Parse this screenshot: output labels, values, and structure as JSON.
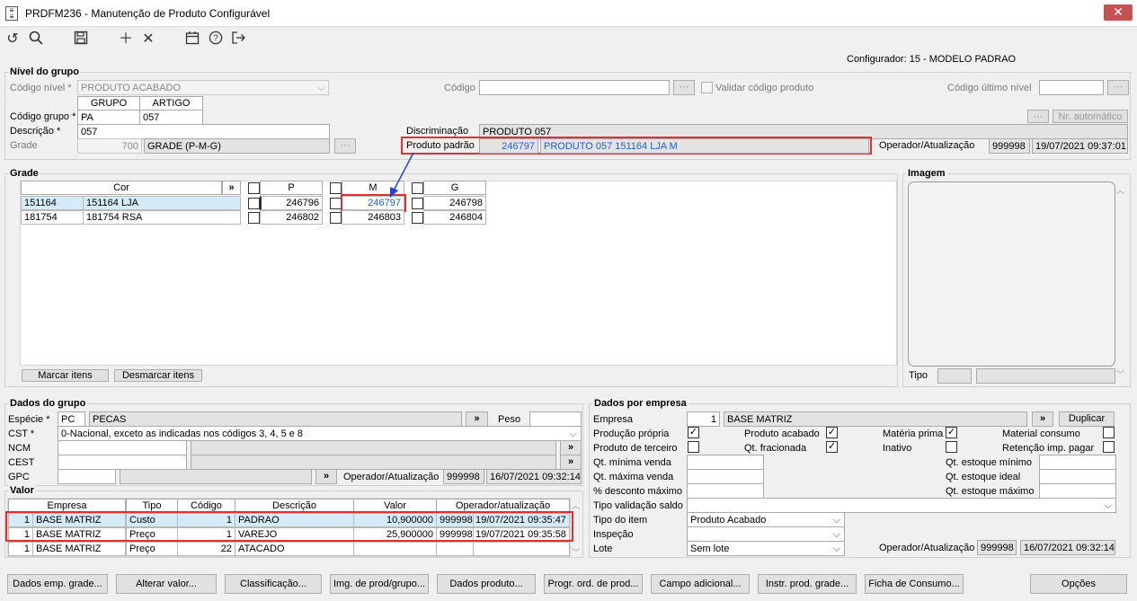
{
  "window": {
    "title": "PRDFM236 - Manutenção de Produto Configurável",
    "close": "✕"
  },
  "configurador": "Configurador: 15 - MODELO PADRAO",
  "nivel": {
    "title": "Nível do grupo",
    "codigo_nivel_label": "Código nível *",
    "codigo_nivel_value": "PRODUTO ACABADO",
    "codigo_label": "Código",
    "validar_label": "Validar código produto",
    "codigo_ultimo_label": "Código último nível",
    "nr_auto": "Nr. automático",
    "grupo_hdr": "GRUPO",
    "artigo_hdr": "ARTIGO",
    "codigo_grupo_label": "Código grupo *",
    "grupo_val": "PA",
    "artigo_val": "057",
    "descricao_label": "Descrição *",
    "descricao_val": "057",
    "grade_label": "Grade",
    "grade_num": "700",
    "grade_desc": "GRADE (P-M-G)",
    "discriminacao_label": "Discriminação",
    "discriminacao_val": "PRODUTO 057",
    "produto_padrao_label": "Produto padrão",
    "produto_padrao_code": "246797",
    "produto_padrao_desc": "PRODUTO 057 151164 LJA M",
    "oper_label": "Operador/Atualização",
    "oper_user": "999998",
    "oper_date": "19/07/2021 09:37:01"
  },
  "grade": {
    "title": "Grade",
    "cor_hdr": "Cor",
    "expand": "»",
    "sizes": [
      "P",
      "M",
      "G"
    ],
    "rows": [
      {
        "code": "151164",
        "name": "151164 LJA",
        "p": "246796",
        "m": "246797",
        "g": "246798"
      },
      {
        "code": "181754",
        "name": "181754 RSA",
        "p": "246802",
        "m": "246803",
        "g": "246804"
      }
    ],
    "marcar": "Marcar itens",
    "desmarcar": "Desmarcar itens"
  },
  "imagem": {
    "title": "Imagem",
    "tipo_label": "Tipo"
  },
  "dados_grupo": {
    "title": "Dados do grupo",
    "especie_label": "Espécie *",
    "especie_code": "PC",
    "especie_desc": "PECAS",
    "peso_label": "Peso",
    "cst_label": "CST *",
    "cst_val": "0-Nacional, exceto as indicadas nos códigos 3, 4, 5 e 8",
    "ncm_label": "NCM",
    "cest_label": "CEST",
    "gpc_label": "GPC",
    "oper_label": "Operador/Atualização",
    "oper_user": "999998",
    "oper_date": "16/07/2021 09:32:14"
  },
  "valor": {
    "title": "Valor",
    "headers": [
      "Empresa",
      "Tipo",
      "Código",
      "Descrição",
      "Valor",
      "Operador/atualização"
    ],
    "rows": [
      {
        "emp_num": "1",
        "empresa": "BASE MATRIZ",
        "tipo": "Custo",
        "codigo": "1",
        "descricao": "PADRAO",
        "valor": "10,900000",
        "user": "999998",
        "date": "19/07/2021 09:35:47"
      },
      {
        "emp_num": "1",
        "empresa": "BASE MATRIZ",
        "tipo": "Preço",
        "codigo": "1",
        "descricao": "VAREJO",
        "valor": "25,900000",
        "user": "999998",
        "date": "19/07/2021 09:35:58"
      },
      {
        "emp_num": "1",
        "empresa": "BASE MATRIZ",
        "tipo": "Preço",
        "codigo": "22",
        "descricao": "ATACADO",
        "valor": "",
        "user": "",
        "date": ""
      }
    ]
  },
  "dados_empresa": {
    "title": "Dados por empresa",
    "empresa_label": "Empresa",
    "empresa_num": "1",
    "empresa_desc": "BASE MATRIZ",
    "duplicar": "Duplicar",
    "producao_propria": "Produção própria",
    "produto_acabado": "Produto acabado",
    "materia_prima": "Matéria prima",
    "material_consumo": "Material consumo",
    "produto_terceiro": "Produto de terceiro",
    "qt_fracionada": "Qt. fracionada",
    "inativo": "Inativo",
    "retencao": "Retenção imp. pagar",
    "qt_min_venda": "Qt. mínima venda",
    "qt_max_venda": "Qt. máxima venda",
    "desc_max": "% desconto máximo",
    "qt_est_min": "Qt. estoque mínimo",
    "qt_est_ideal": "Qt. estoque ideal",
    "qt_est_max": "Qt. estoque máximo",
    "tipo_validacao": "Tipo validação saldo",
    "tipo_item_label": "Tipo do item",
    "tipo_item_val": "Produto Acabado",
    "inspecao_label": "Inspeção",
    "lote_label": "Lote",
    "lote_val": "Sem lote",
    "oper_label": "Operador/Atualização",
    "oper_user": "999998",
    "oper_date": "16/07/2021 09:32:14"
  },
  "bottom_buttons": [
    "Dados emp. grade...",
    "Alterar valor...",
    "Classificação...",
    "Img. de prod/grupo...",
    "Dados produto...",
    "Progr. ord. de prod...",
    "Campo adicional...",
    "Instr. prod. grade...",
    "Ficha de Consumo...",
    "Opções"
  ]
}
